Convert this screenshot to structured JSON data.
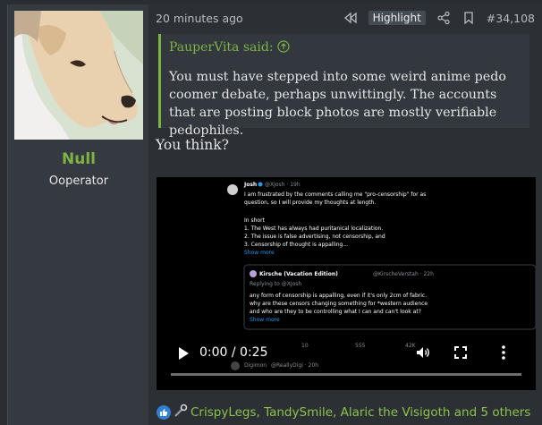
{
  "user": {
    "name": "Null",
    "title": "Ooperator",
    "avatar_icon": "dog-avatar"
  },
  "post": {
    "timestamp": "20 minutes ago",
    "highlight_label": "Highlight",
    "post_number": "#34,108",
    "quote": {
      "author_line": "PauperVita said:",
      "text": "You must have stepped into some weird anime pedo coomer debate, perhaps unwittingly. The accounts that are posting block photos are mostly verifiable pedophiles."
    },
    "reply_text": "You think?"
  },
  "video": {
    "time_display": "0:00 / 0:25",
    "tweet": {
      "author": "Josh",
      "handle": "@XJosh · 19h",
      "lines": [
        "I am frustrated by the comments calling me \"pro-censorship\" for as",
        "question, so I will provide my thoughts at length.",
        "",
        "In short",
        "1. The West has always had puritanical localization.",
        "2. The issue is false advertising, not censorship, and",
        "3. Censorship of thought is appalling..."
      ],
      "show_more": "Show more",
      "quoted": {
        "author": "Kirsche (Vacation Edition)",
        "handle": "@KirscheVerstah · 22h",
        "replying": "Replying to @XJosh",
        "lines": [
          "any form of censorship is appalling, even if it's only 2cm of fabric.",
          "why are these censors changing something for *western audience",
          "and who are they to be controlling what I can and can't look at?"
        ],
        "show_more": "Show more"
      },
      "stats": [
        "10",
        "555",
        "42K"
      ],
      "next_author": "Digimon",
      "next_handle": "@ReallyDigi · 20h"
    }
  },
  "reactions": {
    "text": "CrispyLegs, TandySmile, Alaric the Visigoth and 5 others",
    "icons": [
      "like-icon",
      "ratchet-icon"
    ]
  },
  "colors": {
    "accent_green": "#7cb342",
    "page_bg": "#2a2d31",
    "user_panel_bg": "#353a40"
  }
}
